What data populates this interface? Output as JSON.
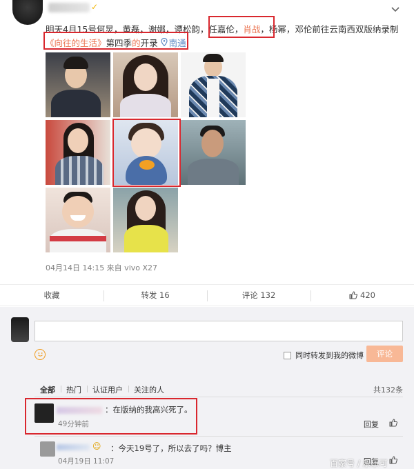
{
  "post": {
    "vip_badge": "✓",
    "line1": {
      "prefix": "明天4月15号何炅，黄磊，谢娜，谭松韵，任嘉伦，",
      "highlight": "肖战",
      "suffix": "，杨幂，邓伦前往云南西双版纳录制"
    },
    "line2": {
      "open_quote": "《",
      "show_name": "向往的生活",
      "close_quote": "》",
      "season": "第四季",
      "de": "的",
      "start": "开录",
      "location": "南通"
    },
    "meta": "04月14日 14:15  来自 vivo X27"
  },
  "actions": {
    "favorite": "收藏",
    "repost": "转发 16",
    "comment": "评论 132",
    "like": "420"
  },
  "composer": {
    "forward_label": "同时转发到我的微博",
    "submit_label": "评论"
  },
  "tabs": {
    "items": [
      "全部",
      "热门",
      "认证用户",
      "关注的人"
    ],
    "total": "共132条"
  },
  "comments": [
    {
      "text": "：在版纳的我高兴死了。",
      "time": "49分钟前",
      "reply": "回复"
    },
    {
      "text": "：今天19号了，所以去了吗？博主",
      "time": "04月19日 11:07",
      "reply": "回复"
    }
  ],
  "watermark": "百家号 / 乐乐可",
  "icons": {
    "chevron": "chevron-down-icon",
    "location": "location-pin-icon",
    "like": "thumbs-up-icon",
    "emoji": "smiley-icon"
  }
}
